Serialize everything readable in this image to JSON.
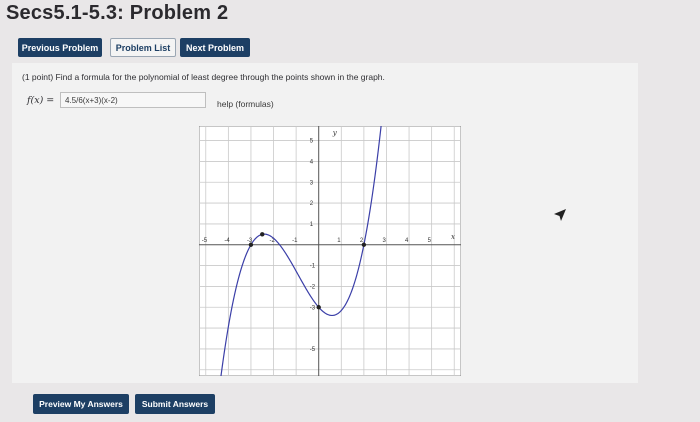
{
  "page": {
    "title": "Secs5.1-5.3: Problem 2"
  },
  "nav": {
    "previous_label": "Previous Problem",
    "list_label": "Problem List",
    "next_label": "Next Problem"
  },
  "problem": {
    "statement": "(1 point) Find a formula for the polynomial of least degree through the points shown in the graph.",
    "fx_label": "f(x) =",
    "answer_value": "4.5/6(x+3)(x-2)",
    "help_label": "help (formulas)"
  },
  "graph": {
    "x_axis_label": "x",
    "y_axis_label": "y",
    "x_ticks": [
      {
        "value": -5,
        "label": "-5"
      },
      {
        "value": -4,
        "label": "-4"
      },
      {
        "value": -3,
        "label": "-3"
      },
      {
        "value": -2,
        "label": "-2"
      },
      {
        "value": -1,
        "label": "-1"
      },
      {
        "value": 1,
        "label": "1"
      },
      {
        "value": 2,
        "label": "2"
      },
      {
        "value": 3,
        "label": "3"
      },
      {
        "value": 4,
        "label": "4"
      },
      {
        "value": 5,
        "label": "5"
      }
    ],
    "y_ticks": [
      {
        "value": 5,
        "label": "5"
      },
      {
        "value": 4,
        "label": "4"
      },
      {
        "value": 3,
        "label": "3"
      },
      {
        "value": 2,
        "label": "2"
      },
      {
        "value": 1,
        "label": "1"
      },
      {
        "value": -1,
        "label": "-1"
      },
      {
        "value": -2,
        "label": "-2"
      },
      {
        "value": -3,
        "label": "-3"
      },
      {
        "value": -5,
        "label": "-5"
      }
    ],
    "xlim": [
      -5.3,
      6.3
    ],
    "ylim": [
      -6.3,
      5.7
    ],
    "grid": true,
    "points": [
      {
        "x": -3,
        "y": 0
      },
      {
        "x": -2.5,
        "y": 0.5
      },
      {
        "x": 0,
        "y": -3
      },
      {
        "x": 2,
        "y": 0
      }
    ],
    "curve_color": "#3b3fa8"
  },
  "actions": {
    "preview_label": "Preview My Answers",
    "submit_label": "Submit Answers"
  },
  "colors": {
    "button_bg": "#1d3f64",
    "page_bg": "#e9e7e8",
    "panel_bg": "#f2f2f2"
  }
}
